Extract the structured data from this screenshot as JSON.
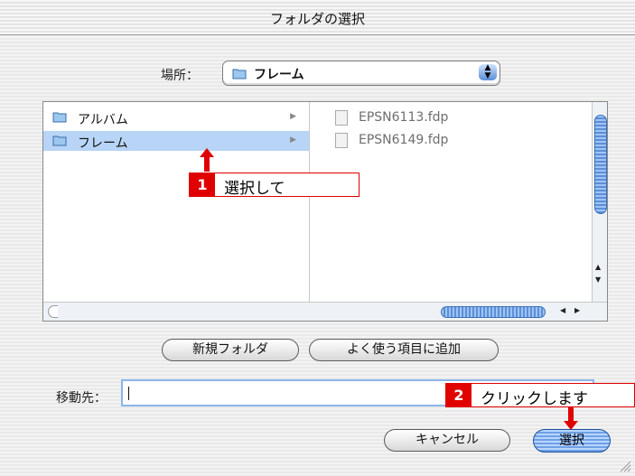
{
  "window": {
    "title": "フォルダの選択"
  },
  "location": {
    "label": "場所：",
    "selected": "フレーム",
    "icon": "folder-icon"
  },
  "column1": {
    "items": [
      {
        "label": "アルバム",
        "icon": "folder-icon",
        "selected": false
      },
      {
        "label": "フレーム",
        "icon": "folder-icon",
        "selected": true
      }
    ]
  },
  "column2": {
    "items": [
      {
        "label": "EPSN6113.fdp",
        "icon": "document-icon"
      },
      {
        "label": "EPSN6149.fdp",
        "icon": "document-icon"
      }
    ]
  },
  "buttons": {
    "new_folder": "新規フォルダ",
    "add_favorite": "よく使う項目に追加",
    "cancel": "キャンセル",
    "select": "選択"
  },
  "destination": {
    "label": "移動先：",
    "value": ""
  },
  "annotations": [
    {
      "num": "1",
      "text": "選択して"
    },
    {
      "num": "2",
      "text": "クリックします"
    }
  ],
  "colors": {
    "accent": "#e00000",
    "selection": "#b8d4f6",
    "aqua": "#5c8fd8"
  }
}
